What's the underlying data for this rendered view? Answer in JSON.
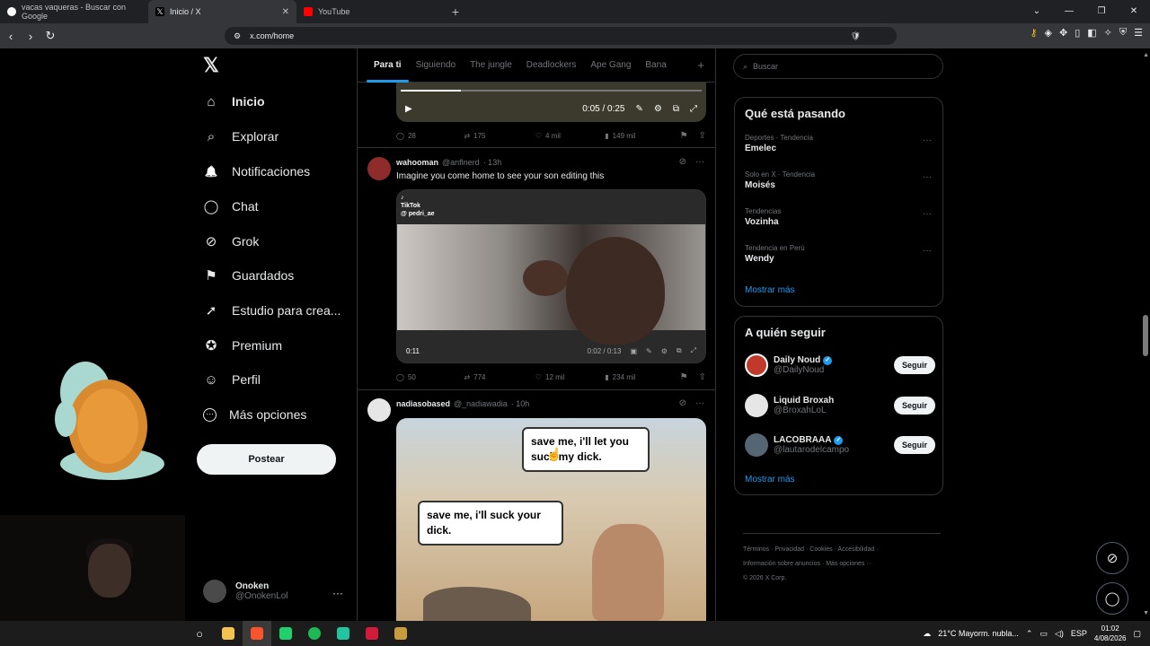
{
  "browser": {
    "tabs": [
      {
        "title": "vacas vaqueras - Buscar con Google",
        "favicon_color": "#ffffff"
      },
      {
        "title": "Inicio / X",
        "favicon_color": "#ffffff"
      },
      {
        "title": "YouTube",
        "favicon_color": "#ff0000"
      }
    ],
    "url": "x.com/home",
    "new_tab": "+"
  },
  "sidebar": {
    "logo": "𝕏",
    "items": [
      {
        "label": "Inicio",
        "icon": "home-icon",
        "glyph": "⌂"
      },
      {
        "label": "Explorar",
        "icon": "search-icon",
        "glyph": "⌕"
      },
      {
        "label": "Notificaciones",
        "icon": "bell-icon",
        "glyph": "🔔"
      },
      {
        "label": "Chat",
        "icon": "chat-icon",
        "glyph": "◯"
      },
      {
        "label": "Grok",
        "icon": "grok-icon",
        "glyph": "⊘"
      },
      {
        "label": "Guardados",
        "icon": "bookmark-icon",
        "glyph": "⚑"
      },
      {
        "label": "Estudio para crea...",
        "icon": "rocket-icon",
        "glyph": "➚"
      },
      {
        "label": "Premium",
        "icon": "premium-icon",
        "glyph": "✪"
      },
      {
        "label": "Perfil",
        "icon": "profile-icon",
        "glyph": "☺"
      },
      {
        "label": "Más opciones",
        "icon": "more-icon",
        "glyph": "⋯"
      }
    ],
    "post_button": "Postear",
    "account": {
      "name": "Onoken",
      "handle": "@OnokenLol"
    }
  },
  "feed": {
    "tabs": [
      "Para ti",
      "Siguiendo",
      "The jungle",
      "Deadlockers",
      "Ape Gang",
      "Bana"
    ],
    "post0": {
      "video_time": "0:05 / 0:25",
      "video_progress": 0.2,
      "replies": "28",
      "reposts": "175",
      "likes": "4 mil",
      "views": "149 mil"
    },
    "post1": {
      "name": "wahooman",
      "handle": "@anflnerd",
      "time": "· 13h",
      "text": "Imagine you come home to see your son editing this",
      "tiktok_label": "TikTok",
      "tiktok_user": "@ pedri_ae",
      "video_elapsed": "0:11",
      "video_time": "0:02 / 0:13",
      "replies": "50",
      "reposts": "774",
      "likes": "12 mil",
      "views": "234 mil"
    },
    "post2": {
      "name": "nadiasobased",
      "handle": "@_nadiawadia",
      "time": "· 10h",
      "bubble_right": "save me, i'll let you suck my dick.",
      "bubble_left": "save me, i'll suck your dick."
    }
  },
  "right": {
    "search_placeholder": "Buscar",
    "trends_title": "Qué está pasando",
    "trends": [
      {
        "meta": "Deportes · Tendencia",
        "name": "Emelec"
      },
      {
        "meta": "Solo en X · Tendencia",
        "name": "Moisés"
      },
      {
        "meta": "Tendencias",
        "name": "Vozinha"
      },
      {
        "meta": "Tendencia en Perú",
        "name": "Wendy"
      }
    ],
    "trends_more": "Mostrar más",
    "follow_title": "A quién seguir",
    "follows": [
      {
        "name": "Daily Noud",
        "handle": "@DailyNoud",
        "verified": true,
        "avatar_color": "#c0392b"
      },
      {
        "name": "Liquid Broxah",
        "handle": "@BroxahLoL",
        "verified": false,
        "avatar_color": "#2c3e50"
      },
      {
        "name": "LACOBRAAA",
        "handle": "@lautarodelcampo",
        "verified": true,
        "avatar_color": "#566573"
      }
    ],
    "follow_button": "Seguir",
    "follow_more": "Mostrar más",
    "footer_line1": "Términos · Privacidad · Cookies · Accesibilidad ·",
    "footer_line2": "Información sobre anuncios · Más opciones ···",
    "footer_line3": "© 2026 X Corp."
  },
  "taskbar": {
    "weather": "21°C  Mayorm. nubla...",
    "lang": "ESP",
    "time": "01:02",
    "date": "4/08/2026"
  }
}
